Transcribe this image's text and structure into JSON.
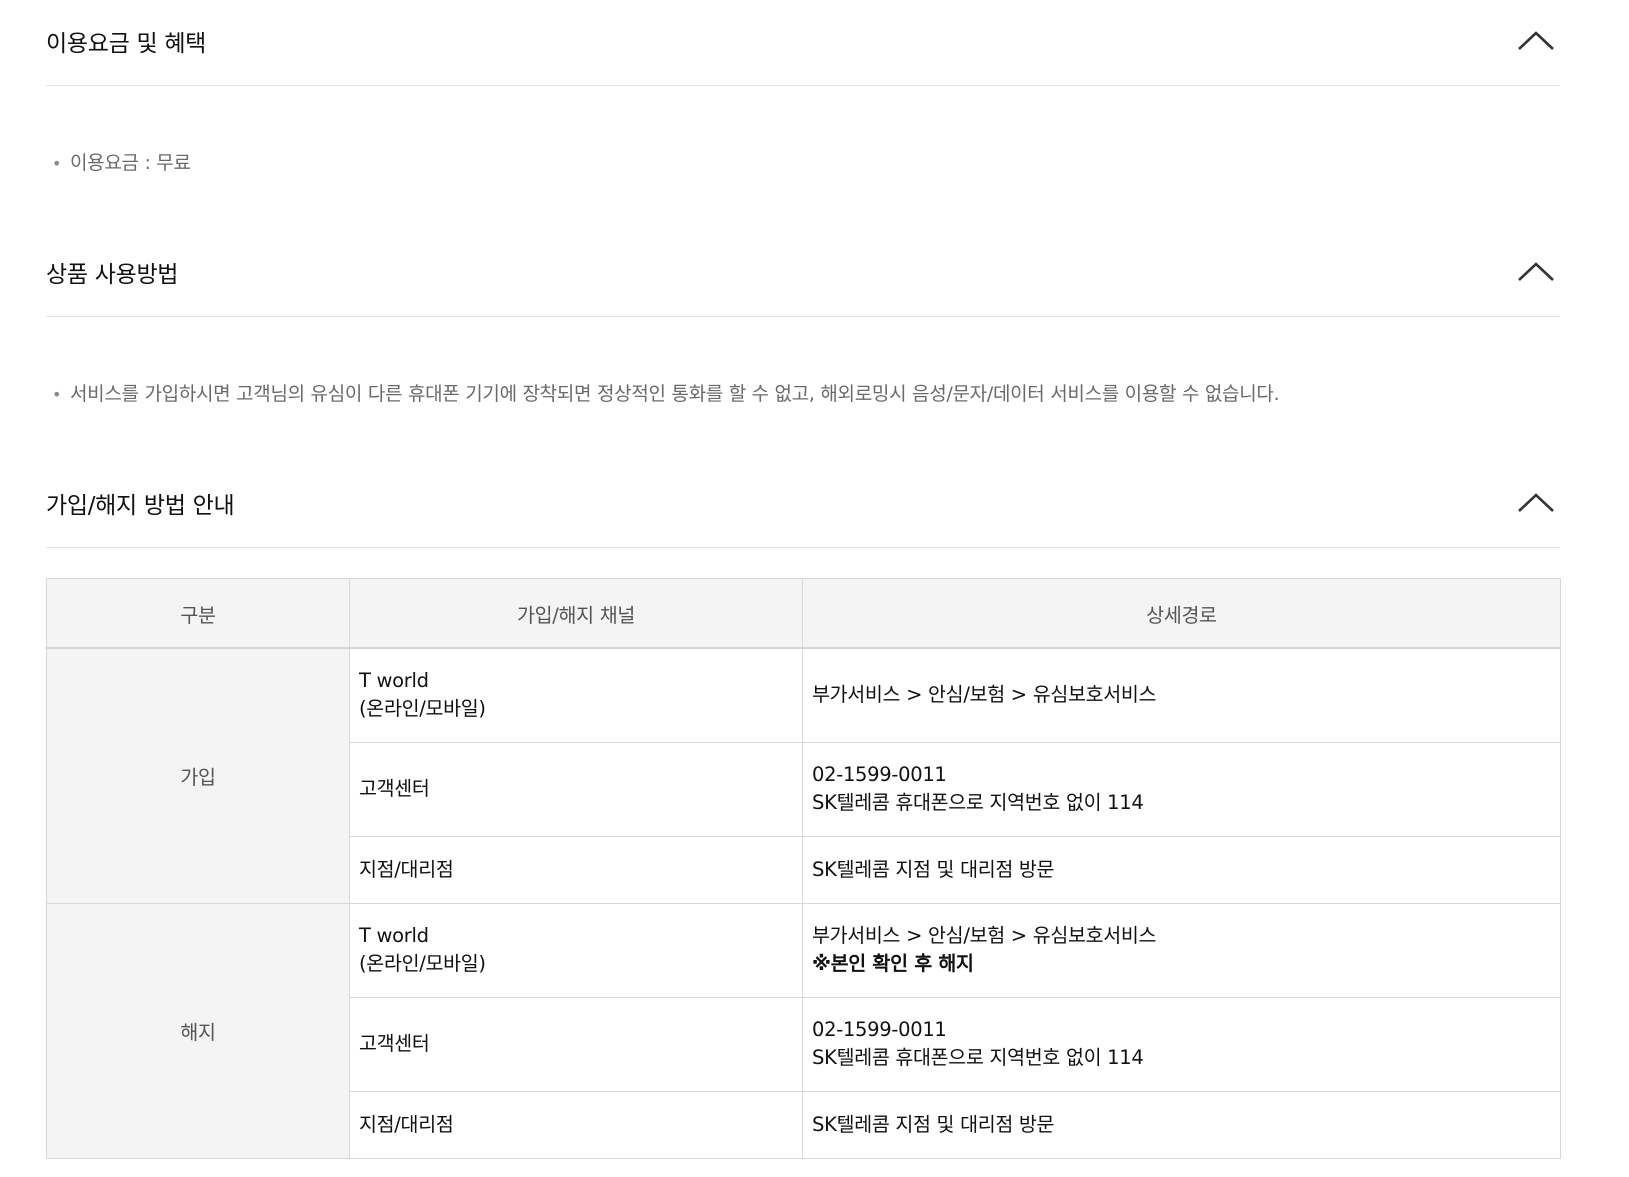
{
  "sections": [
    {
      "title": "이용요금 및 혜택",
      "bullet": "이용요금 : 무료"
    },
    {
      "title": "상품 사용방법",
      "bullet": "서비스를 가입하시면 고객님의 유심이 다른 휴대폰 기기에 장착되면 정상적인 통화를 할 수 없고, 해외로밍시 음성/문자/데이터 서비스를 이용할 수 없습니다."
    },
    {
      "title": "가입/해지 방법 안내"
    }
  ],
  "table": {
    "headers": [
      "구분",
      "가입/해지 채널",
      "상세경로"
    ],
    "groups": [
      {
        "category": "가입",
        "rows": [
          {
            "channel": [
              "T world",
              "(온라인/모바일)"
            ],
            "path": [
              "부가서비스 > 안심/보험 > 유심보호서비스"
            ],
            "note": ""
          },
          {
            "channel": [
              "고객센터"
            ],
            "path": [
              "02-1599-0011",
              "SK텔레콤 휴대폰으로 지역번호 없이 114"
            ],
            "note": ""
          },
          {
            "channel": [
              "지점/대리점"
            ],
            "path": [
              "SK텔레콤 지점 및 대리점 방문"
            ],
            "note": ""
          }
        ]
      },
      {
        "category": "해지",
        "rows": [
          {
            "channel": [
              "T world",
              "(온라인/모바일)"
            ],
            "path": [
              "부가서비스 > 안심/보험 > 유심보호서비스"
            ],
            "note": "※본인 확인 후 해지"
          },
          {
            "channel": [
              "고객센터"
            ],
            "path": [
              "02-1599-0011",
              "SK텔레콤 휴대폰으로 지역번호 없이 114"
            ],
            "note": ""
          },
          {
            "channel": [
              "지점/대리점"
            ],
            "path": [
              "SK텔레콤 지점 및 대리점 방문"
            ],
            "note": ""
          }
        ]
      }
    ]
  },
  "icons": {
    "collapse": "chevron-up-icon",
    "bullet": "bullet-dot-icon"
  },
  "colors": {
    "header_bg": "#f4f4f4",
    "border": "#d8d8d8",
    "muted_text": "#6a6a6a"
  }
}
